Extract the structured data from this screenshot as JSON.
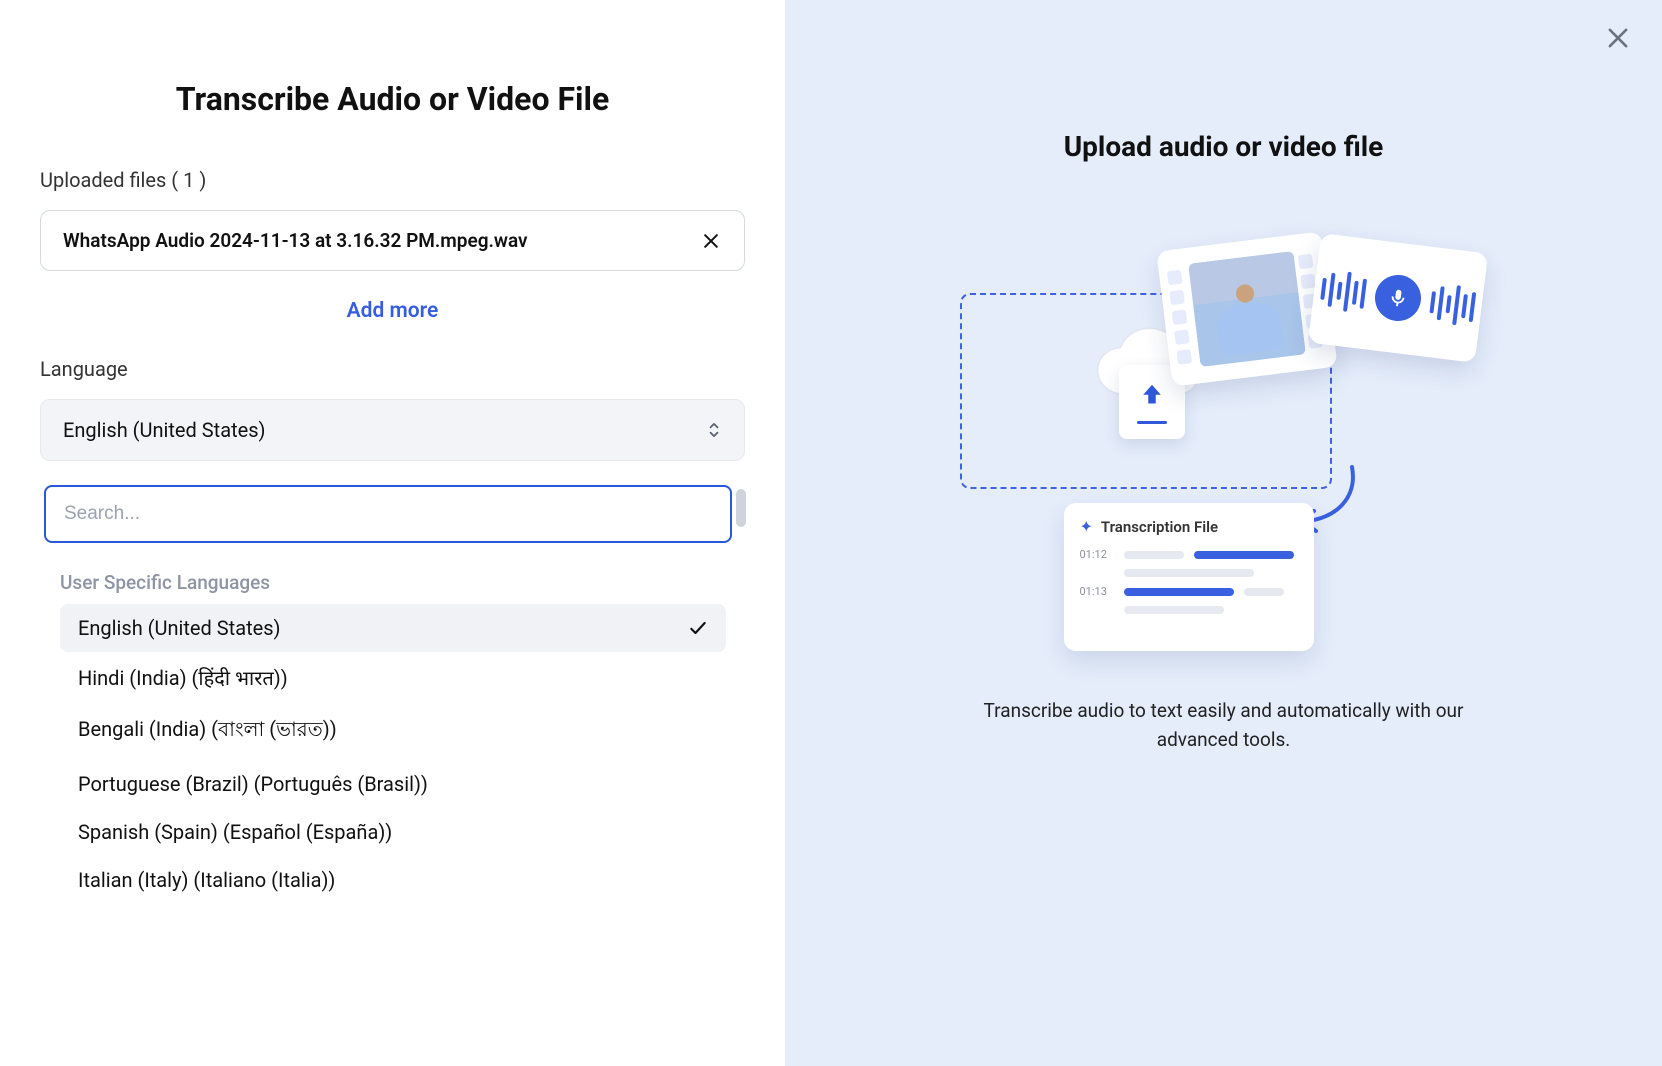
{
  "left": {
    "title": "Transcribe Audio or Video File",
    "uploaded_label": "Uploaded files ( 1 )",
    "files": [
      {
        "name": "WhatsApp Audio 2024-11-13 at 3.16.32 PM.mpeg.wav"
      }
    ],
    "add_more": "Add more",
    "language_label": "Language",
    "selected_language": "English (United States)",
    "search_placeholder": "Search...",
    "group_header": "User Specific Languages",
    "options": [
      {
        "label": "English (United States)",
        "selected": true
      },
      {
        "label": "Hindi (India) (हिंदी भारत))"
      },
      {
        "label": "Bengali (India) (বাংলা (ভারত))"
      },
      {
        "label": "Portuguese (Brazil) (Português (Brasil))"
      },
      {
        "label": "Spanish (Spain) (Español (España))"
      },
      {
        "label": "Italian (Italy) (Italiano (Italia))"
      }
    ]
  },
  "right": {
    "title": "Upload audio or video file",
    "transcript_title": "Transcription File",
    "ts1": "01:12",
    "ts2": "01:13",
    "description": "Transcribe audio to text easily and automatically with our advanced tools."
  }
}
